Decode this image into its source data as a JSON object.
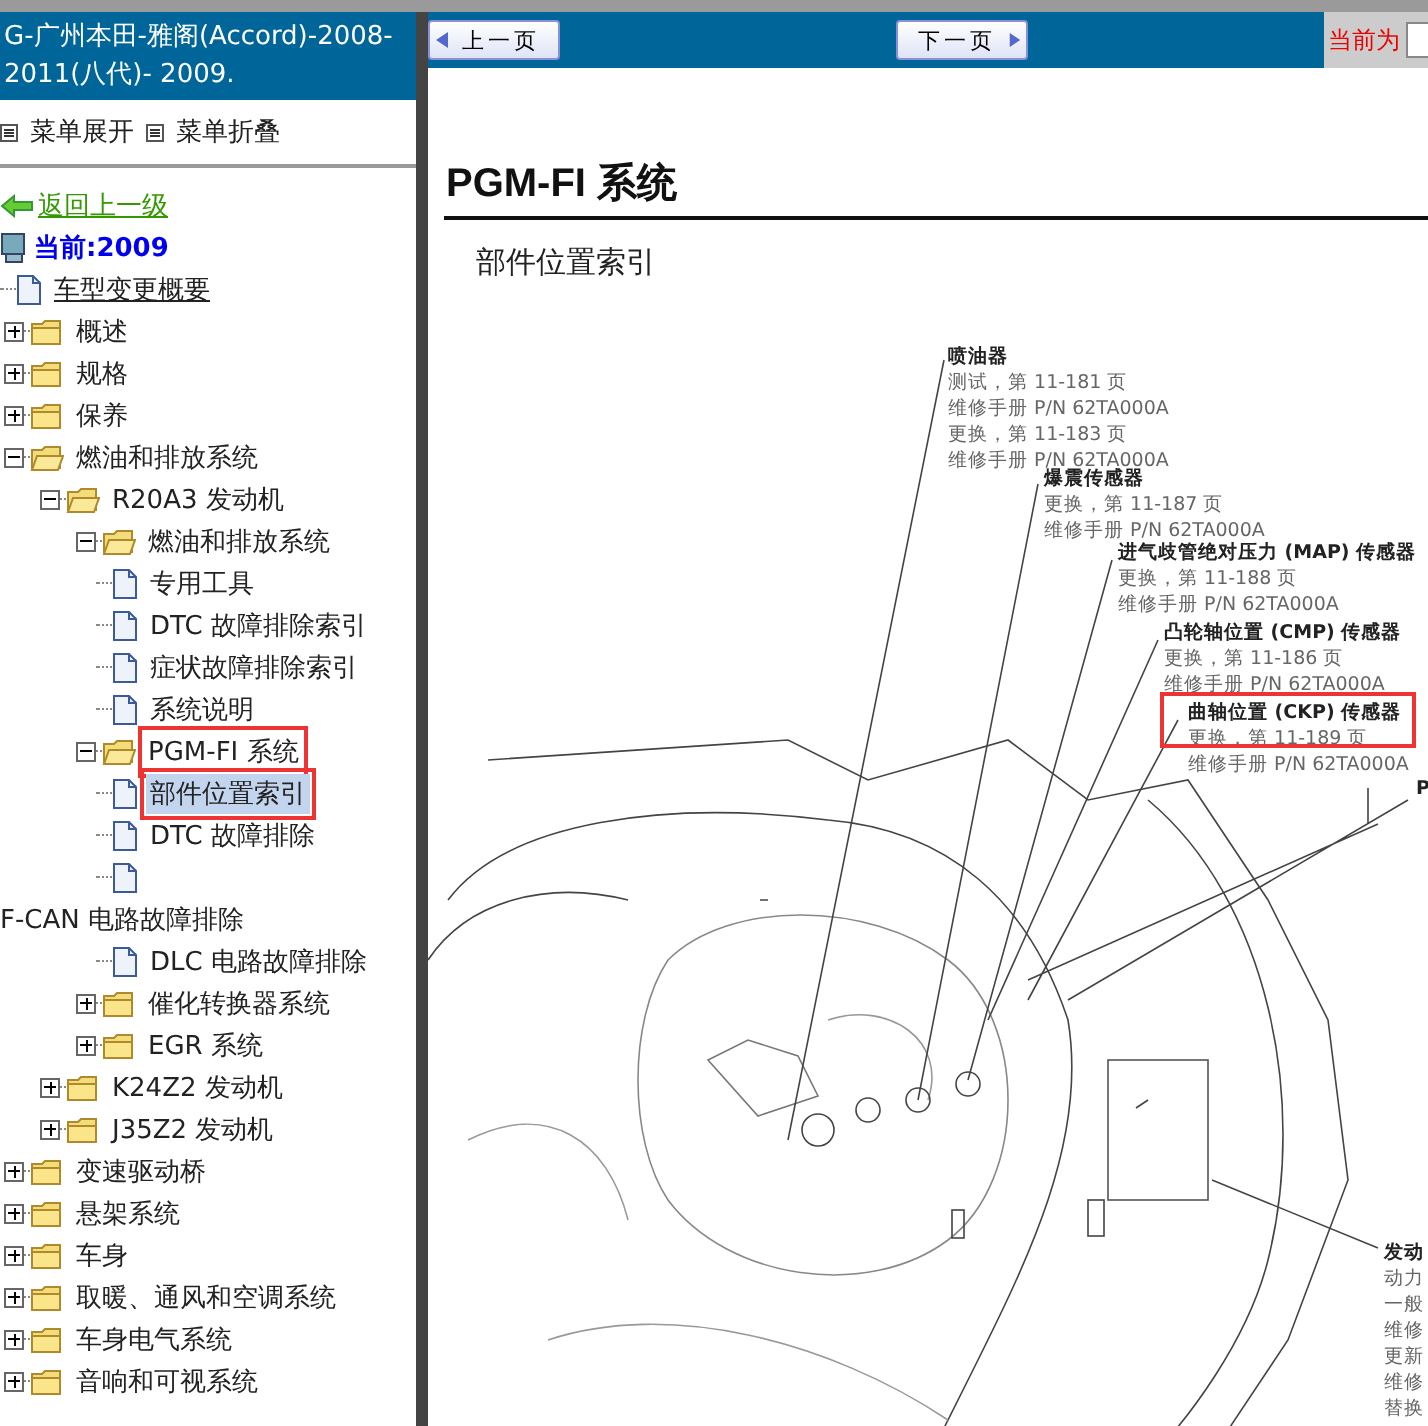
{
  "sidebar": {
    "title": "G-广州本田-雅阁(Accord)-2008-2011(八代)- 2009.",
    "menu_actions": [
      "菜单展开",
      "菜单折叠"
    ],
    "back_link": "返回上一级",
    "current": "当前:2009",
    "tree": [
      {
        "label": "车型变更概要",
        "kind": "page",
        "selected": false,
        "hovered": true,
        "highlighted": false
      },
      {
        "label": "概述",
        "kind": "folder",
        "expanded": false,
        "selected": false,
        "highlighted": false
      },
      {
        "label": "规格",
        "kind": "folder",
        "expanded": false,
        "selected": false,
        "highlighted": false
      },
      {
        "label": "保养",
        "kind": "folder",
        "expanded": false,
        "selected": false,
        "highlighted": false
      },
      {
        "label": "燃油和排放系统",
        "kind": "folder",
        "expanded": true,
        "selected": false,
        "highlighted": false,
        "children": [
          {
            "label": "R20A3 发动机",
            "kind": "folder",
            "expanded": true,
            "selected": false,
            "highlighted": false,
            "children": [
              {
                "label": "燃油和排放系统",
                "kind": "folder",
                "expanded": true,
                "selected": false,
                "highlighted": false,
                "children": [
                  {
                    "label": "专用工具",
                    "kind": "page",
                    "selected": false,
                    "hovered": false,
                    "highlighted": false
                  },
                  {
                    "label": "DTC 故障排除索引",
                    "kind": "page",
                    "selected": false,
                    "hovered": false,
                    "highlighted": false
                  },
                  {
                    "label": "症状故障排除索引",
                    "kind": "page",
                    "selected": false,
                    "hovered": false,
                    "highlighted": false
                  },
                  {
                    "label": "系统说明",
                    "kind": "page",
                    "selected": false,
                    "hovered": false,
                    "highlighted": false
                  }
                ]
              },
              {
                "label": "PGM-FI 系统",
                "kind": "folder",
                "expanded": true,
                "selected": false,
                "highlighted": true,
                "children": [
                  {
                    "label": "部件位置索引",
                    "kind": "page",
                    "selected": true,
                    "hovered": false,
                    "highlighted": true
                  },
                  {
                    "label": "DTC 故障排除",
                    "kind": "page",
                    "selected": false,
                    "hovered": false,
                    "highlighted": false
                  },
                  {
                    "label": "F-CAN 电路故障排除",
                    "kind": "wrapped",
                    "selected": false,
                    "hovered": false,
                    "highlighted": false
                  },
                  {
                    "label": "DLC 电路故障排除",
                    "kind": "page",
                    "selected": false,
                    "hovered": false,
                    "highlighted": false
                  }
                ]
              },
              {
                "label": "催化转换器系统",
                "kind": "folder",
                "expanded": false,
                "selected": false,
                "highlighted": false
              },
              {
                "label": "EGR 系统",
                "kind": "folder",
                "expanded": false,
                "selected": false,
                "highlighted": false
              }
            ]
          },
          {
            "label": "K24Z2 发动机",
            "kind": "folder",
            "expanded": false,
            "selected": false,
            "highlighted": false
          },
          {
            "label": "J35Z2 发动机",
            "kind": "folder",
            "expanded": false,
            "selected": false,
            "highlighted": false
          }
        ]
      },
      {
        "label": "变速驱动桥",
        "kind": "folder",
        "expanded": false,
        "selected": false,
        "highlighted": false
      },
      {
        "label": "悬架系统",
        "kind": "folder",
        "expanded": false,
        "selected": false,
        "highlighted": false
      },
      {
        "label": "车身",
        "kind": "folder",
        "expanded": false,
        "selected": false,
        "highlighted": false
      },
      {
        "label": "取暖、通风和空调系统",
        "kind": "folder",
        "expanded": false,
        "selected": false,
        "highlighted": false
      },
      {
        "label": "车身电气系统",
        "kind": "folder",
        "expanded": false,
        "selected": false,
        "highlighted": false
      },
      {
        "label": "音响和可视系统",
        "kind": "folder",
        "expanded": false,
        "selected": false,
        "highlighted": false
      }
    ]
  },
  "toolbar": {
    "prev": "上一页",
    "next": "下一页",
    "current_label": "当前为"
  },
  "document": {
    "title": "PGM-FI 系统",
    "subtitle": "部件位置索引",
    "callouts": [
      {
        "heading": "喷油器",
        "lines": [
          "测试，第 11-181 页",
          "维修手册 P/N 62TA000A",
          "更换，第 11-183 页",
          "维修手册 P/N 62TA000A"
        ],
        "highlighted": false
      },
      {
        "heading": "爆震传感器",
        "lines": [
          "更换，第 11-187 页",
          "维修手册 P/N 62TA000A"
        ],
        "highlighted": false
      },
      {
        "heading": "进气歧管绝对压力 (MAP) 传感器",
        "lines": [
          "更换，第 11-188 页",
          "维修手册 P/N 62TA000A"
        ],
        "highlighted": false
      },
      {
        "heading": "凸轮轴位置 (CMP) 传感器",
        "lines": [
          "更换，第 11-186 页",
          "维修手册 P/N 62TA000A"
        ],
        "highlighted": false
      },
      {
        "heading": "曲轴位置 (CKP) 传感器",
        "lines": [
          "更换，第 11-189 页",
          "维修手册 P/N 62TA000A"
        ],
        "highlighted": true
      },
      {
        "heading": "P",
        "highlighted": false
      },
      {
        "heading": "发动",
        "lines": [
          "动力",
          "一般",
          "维修",
          "更新",
          "维修",
          "替换"
        ],
        "highlighted": false
      }
    ]
  }
}
